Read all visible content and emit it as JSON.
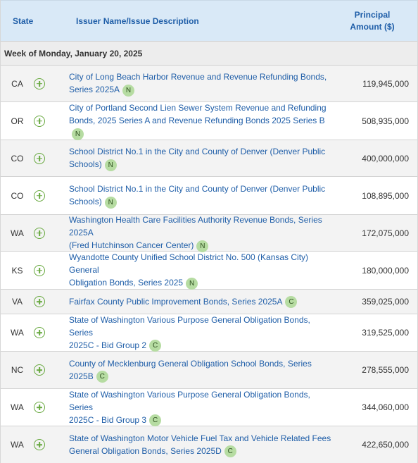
{
  "header": {
    "state": "State",
    "description": "Issuer Name/Issue Description",
    "amount_line1": "Principal",
    "amount_line2": "Amount ($)"
  },
  "week_label": "Week of Monday, January 20, 2025",
  "colors": {
    "accent": "#1f5ea8",
    "header_bg": "#d9e9f7",
    "plus": "#67a83e",
    "badge_bg": "#b6dca2"
  },
  "rows": [
    {
      "state": "CA",
      "desc1": "City of Long Beach Harbor Revenue and Revenue Refunding Bonds,",
      "desc2": "Series 2025A",
      "badge": "N",
      "amount": "119,945,000"
    },
    {
      "state": "OR",
      "desc1": "City of Portland Second Lien Sewer System Revenue and Refunding",
      "desc2": "Bonds, 2025 Series A and Revenue Refunding Bonds 2025 Series B",
      "badge": "N",
      "amount": "508,935,000"
    },
    {
      "state": "CO",
      "desc1": "School District No.1 in the City and County of Denver (Denver Public",
      "desc2": "Schools)",
      "badge": "N",
      "amount": "400,000,000"
    },
    {
      "state": "CO",
      "desc1": "School District No.1 in the City and County of Denver (Denver Public",
      "desc2": "Schools)",
      "badge": "N",
      "amount": "108,895,000"
    },
    {
      "state": "WA",
      "desc1": "Washington Health Care Facilities Authority Revenue Bonds, Series 2025A",
      "desc2": "(Fred Hutchinson Cancer Center)",
      "badge": "N",
      "amount": "172,075,000"
    },
    {
      "state": "KS",
      "desc1": "Wyandotte County Unified School District No. 500 (Kansas City) General",
      "desc2": "Obligation Bonds, Series 2025",
      "badge": "N",
      "amount": "180,000,000"
    },
    {
      "state": "VA",
      "desc1": "Fairfax County Public Improvement Bonds, Series 2025A",
      "desc2": "",
      "badge": "C",
      "amount": "359,025,000"
    },
    {
      "state": "WA",
      "desc1": "State of Washington Various Purpose General Obligation Bonds, Series",
      "desc2": "2025C - Bid Group 2",
      "badge": "C",
      "amount": "319,525,000"
    },
    {
      "state": "NC",
      "desc1": "County of Mecklenburg General Obligation School Bonds, Series 2025B",
      "desc2": "",
      "badge": "C",
      "amount": "278,555,000"
    },
    {
      "state": "WA",
      "desc1": "State of Washington Various Purpose General Obligation Bonds, Series",
      "desc2": "2025C - Bid Group 3",
      "badge": "C",
      "amount": "344,060,000"
    },
    {
      "state": "WA",
      "desc1": "State of Washington Motor Vehicle Fuel Tax and Vehicle Related Fees",
      "desc2": "General Obligation Bonds, Series 2025D",
      "badge": "C",
      "amount": "422,650,000"
    }
  ]
}
